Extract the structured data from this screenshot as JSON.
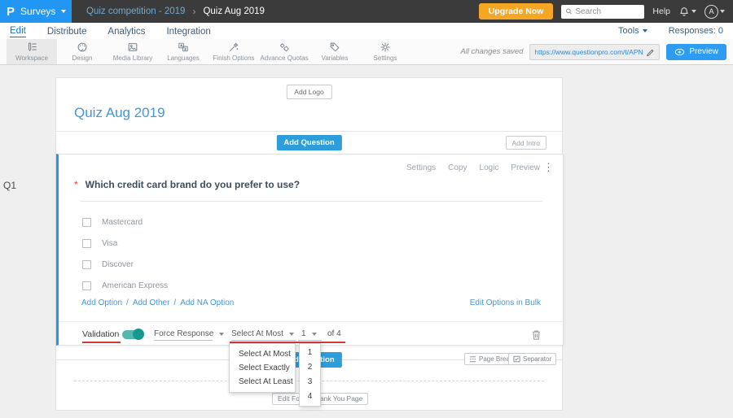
{
  "colors": {
    "brand_blue": "#2196f3",
    "action_blue": "#2d9ddb",
    "upgrade_orange": "#f5a623",
    "toggle_teal": "#55b8ad",
    "annotation_red": "#cc3a3a",
    "title_blue": "#4596d1"
  },
  "topbar": {
    "logo": "P",
    "product": "Surveys",
    "breadcrumb": {
      "parent": "Quiz competition - 2019",
      "chevron": "›",
      "current": "Quiz Aug 2019"
    },
    "upgrade": "Upgrade Now",
    "search_placeholder": "Search",
    "help": "Help",
    "avatar": "A"
  },
  "nav": {
    "tabs": [
      {
        "label": "Edit"
      },
      {
        "label": "Distribute"
      },
      {
        "label": "Analytics"
      },
      {
        "label": "Integration"
      }
    ],
    "tools": "Tools",
    "responses": "Responses: 0"
  },
  "toolbar": {
    "items": [
      {
        "label": "Workspace"
      },
      {
        "label": "Design"
      },
      {
        "label": "Media Library"
      },
      {
        "label": "Languages"
      },
      {
        "label": "Finish Options"
      },
      {
        "label": "Advance Quotas"
      },
      {
        "label": "Variables"
      },
      {
        "label": "Settings"
      }
    ],
    "saved": "All changes saved",
    "url": "https://www.questionpro.com/t/APNrFZ",
    "preview": "Preview"
  },
  "page": {
    "q_label": "Q1",
    "add_logo": "Add Logo",
    "title": "Quiz Aug 2019",
    "add_question": "Add Question",
    "add_intro": "Add Intro"
  },
  "question": {
    "actions": [
      "Settings",
      "Copy",
      "Logic",
      "Preview"
    ],
    "more_icon": "⋮",
    "required": "*",
    "text": "Which credit card brand do you prefer to use?",
    "options": [
      "Mastercard",
      "Visa",
      "Discover",
      "American Express"
    ],
    "add_option": "Add Option",
    "add_other": "Add Other",
    "add_na": "Add NA Option",
    "separator": "/",
    "bulk": "Edit Options in Bulk",
    "validation": "Validation",
    "force_response": "Force Response",
    "rule": "Select At Most",
    "count": "1",
    "of": "of 4"
  },
  "menus": {
    "rules": [
      "Select At Most",
      "Select Exactly",
      "Select At Least"
    ],
    "counts": [
      "1",
      "2",
      "3",
      "4"
    ]
  },
  "footer": {
    "add_question": "Add Question",
    "page_break": "Page Break",
    "separator": "Separator",
    "edit_footer": "Edit Footer",
    "thank_you": "Thank You Page"
  }
}
